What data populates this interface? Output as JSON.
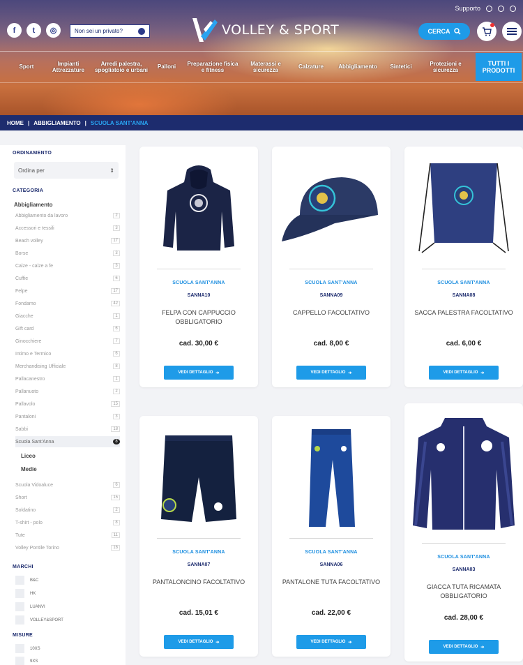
{
  "header": {
    "support_label": "Supporto",
    "private_button": "Non sei un privato?",
    "logo_text": "VOLLEY & SPORT",
    "search_label": "CERCA",
    "social": [
      "f",
      "t",
      "◎"
    ],
    "all_products": "TUTTI I PRODOTTI",
    "nav": [
      "Sport",
      "Impianti Attrezzature",
      "Arredi palestra, spogliatoio e urbani",
      "Palloni",
      "Preparazione fisica e fitness",
      "Materassi e sicurezza",
      "Calzature",
      "Abbigliamento",
      "Sintetici",
      "Protezioni e sicurezza"
    ]
  },
  "breadcrumb": {
    "home": "HOME",
    "section": "ABBIGLIAMENTO",
    "current": "SCUOLA SANT'ANNA",
    "separator": "|"
  },
  "sidebar": {
    "sort_title": "ORDINAMENTO",
    "sort_value": "Ordina per",
    "category_title": "CATEGORIA",
    "category_head": "Abbigliamento",
    "categories": [
      {
        "label": "Abbigliamento da lavoro",
        "count": "2"
      },
      {
        "label": "Accessori e tessili",
        "count": "3"
      },
      {
        "label": "Beach volley",
        "count": "17"
      },
      {
        "label": "Borse",
        "count": "3"
      },
      {
        "label": "Calze - calze a fe",
        "count": "3"
      },
      {
        "label": "Cuffie",
        "count": "6"
      },
      {
        "label": "Felpe",
        "count": "17"
      },
      {
        "label": "Fondamo",
        "count": "42"
      },
      {
        "label": "Giacche",
        "count": "1"
      },
      {
        "label": "Gift card",
        "count": "6"
      },
      {
        "label": "Ginocchiere",
        "count": "7"
      },
      {
        "label": "Intimo e Termico",
        "count": "6"
      },
      {
        "label": "Merchandising Ufficiale",
        "count": "8"
      },
      {
        "label": "Pallacanestro",
        "count": "1"
      },
      {
        "label": "Pallanuoto",
        "count": "2"
      },
      {
        "label": "Pallavolo",
        "count": "15"
      },
      {
        "label": "Pantaloni",
        "count": "3"
      },
      {
        "label": "Sabbi",
        "count": "18"
      },
      {
        "label": "Scuola Sant'Anna",
        "count": "8"
      }
    ],
    "subcategories": [
      "Liceo",
      "Medie"
    ],
    "categories_after": [
      {
        "label": "Scuola Vidoaluce",
        "count": "6"
      },
      {
        "label": "Short",
        "count": "15"
      },
      {
        "label": "Soldatino",
        "count": "2"
      },
      {
        "label": "T-shirt - polo",
        "count": "8"
      },
      {
        "label": "Tute",
        "count": "11"
      },
      {
        "label": "Volley Pontile Torino",
        "count": "16"
      }
    ],
    "brands_title": "MARCHI",
    "brands": [
      "B&C",
      "HK",
      "LUANVI",
      "VOLLEY&SPORT"
    ],
    "sizes_title": "MISURE",
    "sizes": [
      "10XS",
      "9XS"
    ]
  },
  "products": [
    {
      "brand": "SCUOLA SANT'ANNA",
      "code": "SANNA10",
      "name": "FELPA CON CAPPUCCIO OBBLIGATORIO",
      "price": "cad. 30,00 €",
      "button": "VEDI DETTAGLIO",
      "image": "hoodie"
    },
    {
      "brand": "SCUOLA SANT'ANNA",
      "code": "SANNA09",
      "name": "CAPPELLO FACOLTATIVO",
      "price": "cad. 8,00 €",
      "button": "VEDI DETTAGLIO",
      "image": "cap"
    },
    {
      "brand": "SCUOLA SANT'ANNA",
      "code": "SANNA08",
      "name": "SACCA PALESTRA FACOLTATIVO",
      "price": "cad. 6,00 €",
      "button": "VEDI DETTAGLIO",
      "image": "bag"
    },
    {
      "brand": "SCUOLA SANT'ANNA",
      "code": "SANNA07",
      "name": "PANTALONCINO FACOLTATIVO",
      "price": "cad. 15,01 €",
      "button": "VEDI DETTAGLIO",
      "image": "shorts"
    },
    {
      "brand": "SCUOLA SANT'ANNA",
      "code": "SANNA06",
      "name": "PANTALONE TUTA FACOLTATIVO",
      "price": "cad. 22,00 €",
      "button": "VEDI DETTAGLIO",
      "image": "pants"
    },
    {
      "brand": "SCUOLA SANT'ANNA",
      "code": "SANNA03",
      "name": "GIACCA TUTA RICAMATA OBBLIGATORIO",
      "price": "cad. 28,00 €",
      "button": "VEDI DETTAGLIO",
      "image": "jacket"
    }
  ],
  "colors": {
    "accent": "#1e9be8",
    "navy": "#1d2c6e"
  }
}
